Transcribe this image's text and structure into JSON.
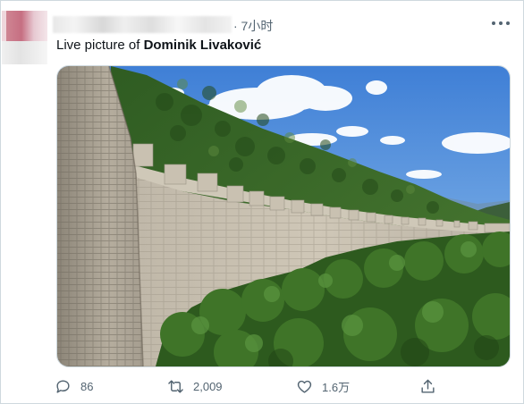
{
  "tweet": {
    "timestamp": "· 7小时",
    "text_prefix": "Live picture of ",
    "text_bold": "Dominik Livaković",
    "image": "photo of a long medieval stone wall with battlements along a green hillside under a blue sky"
  },
  "actions": {
    "replies": "86",
    "retweets": "2,009",
    "likes": "1.6万"
  },
  "icons": {
    "reply": "reply-icon",
    "retweet": "retweet-icon",
    "like": "heart-icon",
    "share": "share-icon",
    "more": "more-dots-icon"
  },
  "colors": {
    "text": "#0f1419",
    "muted": "#536471",
    "border": "#cfd9de"
  }
}
